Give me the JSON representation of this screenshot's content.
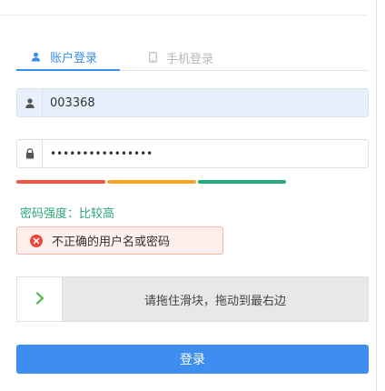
{
  "tabs": [
    {
      "label": "账户登录",
      "icon": "user-icon",
      "active": true
    },
    {
      "label": "手机登录",
      "icon": "mobile-phone-icon",
      "active": false
    }
  ],
  "username": {
    "value": "003368",
    "icon": "user-icon"
  },
  "password": {
    "value": "••••••••••••••••",
    "icon": "lock-icon"
  },
  "strength": {
    "label": "密码强度：比较高",
    "bars": [
      "#f0564a",
      "#f5a623",
      "#2aa876"
    ],
    "text_color": "#2aa876"
  },
  "error": {
    "message": "不正确的用户名或密码",
    "icon": "error-circle-icon",
    "color": "#e9493c",
    "background": "#fdefeb"
  },
  "slider": {
    "label": "请拖住滑块，拖动到最右边",
    "icon": "chevron-right-icon",
    "icon_color": "#4cb84b"
  },
  "login_button": {
    "label": "登录",
    "color": "#3d8ef0"
  },
  "colors": {
    "accent": "#3a8ee6"
  }
}
